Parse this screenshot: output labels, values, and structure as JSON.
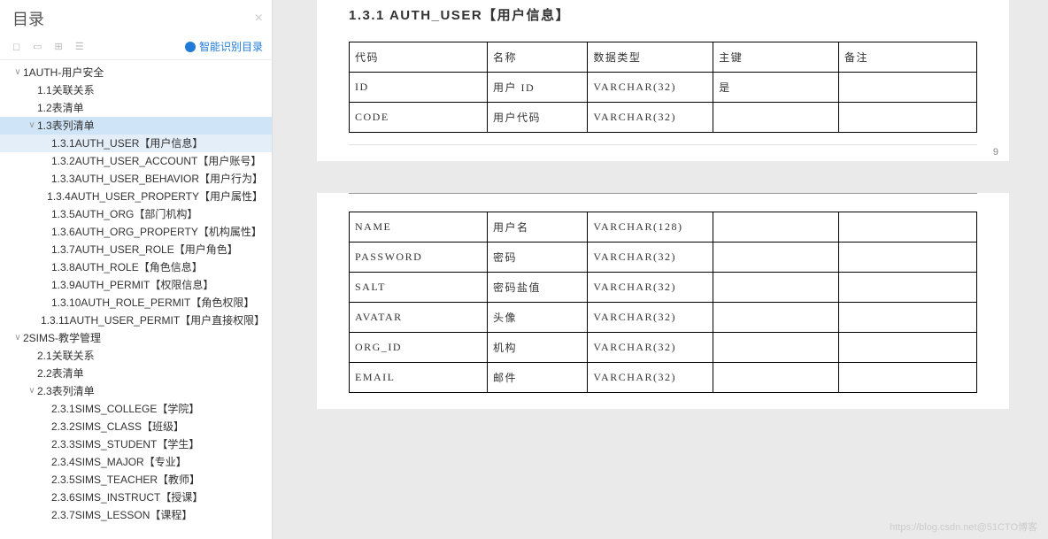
{
  "sidebar": {
    "title": "目录",
    "smart_label": "智能识别目录"
  },
  "tree": [
    {
      "lbl": "1AUTH-用户安全",
      "depth": 0,
      "tw": "v"
    },
    {
      "lbl": "1.1关联关系",
      "depth": 1,
      "tw": ""
    },
    {
      "lbl": "1.2表清单",
      "depth": 1,
      "tw": ""
    },
    {
      "lbl": "1.3表列清单",
      "depth": 1,
      "tw": "v",
      "sel": "sec"
    },
    {
      "lbl": "1.3.1AUTH_USER【用户信息】",
      "depth": 2,
      "tw": "",
      "sel": "leaf"
    },
    {
      "lbl": "1.3.2AUTH_USER_ACCOUNT【用户账号】",
      "depth": 2,
      "tw": ""
    },
    {
      "lbl": "1.3.3AUTH_USER_BEHAVIOR【用户行为】",
      "depth": 2,
      "tw": ""
    },
    {
      "lbl": "1.3.4AUTH_USER_PROPERTY【用户属性】",
      "depth": 2,
      "tw": ""
    },
    {
      "lbl": "1.3.5AUTH_ORG【部门机构】",
      "depth": 2,
      "tw": ""
    },
    {
      "lbl": "1.3.6AUTH_ORG_PROPERTY【机构属性】",
      "depth": 2,
      "tw": ""
    },
    {
      "lbl": "1.3.7AUTH_USER_ROLE【用户角色】",
      "depth": 2,
      "tw": ""
    },
    {
      "lbl": "1.3.8AUTH_ROLE【角色信息】",
      "depth": 2,
      "tw": ""
    },
    {
      "lbl": "1.3.9AUTH_PERMIT【权限信息】",
      "depth": 2,
      "tw": ""
    },
    {
      "lbl": "1.3.10AUTH_ROLE_PERMIT【角色权限】",
      "depth": 2,
      "tw": ""
    },
    {
      "lbl": "1.3.11AUTH_USER_PERMIT【用户直接权限】",
      "depth": 2,
      "tw": ""
    },
    {
      "lbl": "2SIMS-教学管理",
      "depth": 0,
      "tw": "v"
    },
    {
      "lbl": "2.1关联关系",
      "depth": 1,
      "tw": ""
    },
    {
      "lbl": "2.2表清单",
      "depth": 1,
      "tw": ""
    },
    {
      "lbl": "2.3表列清单",
      "depth": 1,
      "tw": "v"
    },
    {
      "lbl": "2.3.1SIMS_COLLEGE【学院】",
      "depth": 2,
      "tw": ""
    },
    {
      "lbl": "2.3.2SIMS_CLASS【班级】",
      "depth": 2,
      "tw": ""
    },
    {
      "lbl": "2.3.3SIMS_STUDENT【学生】",
      "depth": 2,
      "tw": ""
    },
    {
      "lbl": "2.3.4SIMS_MAJOR【专业】",
      "depth": 2,
      "tw": ""
    },
    {
      "lbl": "2.3.5SIMS_TEACHER【教师】",
      "depth": 2,
      "tw": ""
    },
    {
      "lbl": "2.3.6SIMS_INSTRUCT【授课】",
      "depth": 2,
      "tw": ""
    },
    {
      "lbl": "2.3.7SIMS_LESSON【课程】",
      "depth": 2,
      "tw": ""
    }
  ],
  "doc": {
    "heading": "1.3.1  AUTH_USER【用户信息】",
    "page_number": "9",
    "headers": [
      "代码",
      "名称",
      "数据类型",
      "主键",
      "备注"
    ],
    "rows1": [
      [
        "ID",
        "用户 ID",
        "VARCHAR(32)",
        "是",
        ""
      ],
      [
        "CODE",
        "用户代码",
        "VARCHAR(32)",
        "",
        ""
      ]
    ],
    "rows2": [
      [
        "NAME",
        "用户名",
        "VARCHAR(128)",
        "",
        ""
      ],
      [
        "PASSWORD",
        "密码",
        "VARCHAR(32)",
        "",
        ""
      ],
      [
        "SALT",
        "密码盐值",
        "VARCHAR(32)",
        "",
        ""
      ],
      [
        "AVATAR",
        "头像",
        "VARCHAR(32)",
        "",
        ""
      ],
      [
        "ORG_ID",
        "机构",
        "VARCHAR(32)",
        "",
        ""
      ],
      [
        "EMAIL",
        "邮件",
        "VARCHAR(32)",
        "",
        ""
      ]
    ]
  },
  "watermark": "https://blog.csdn.net@51CTO博客"
}
